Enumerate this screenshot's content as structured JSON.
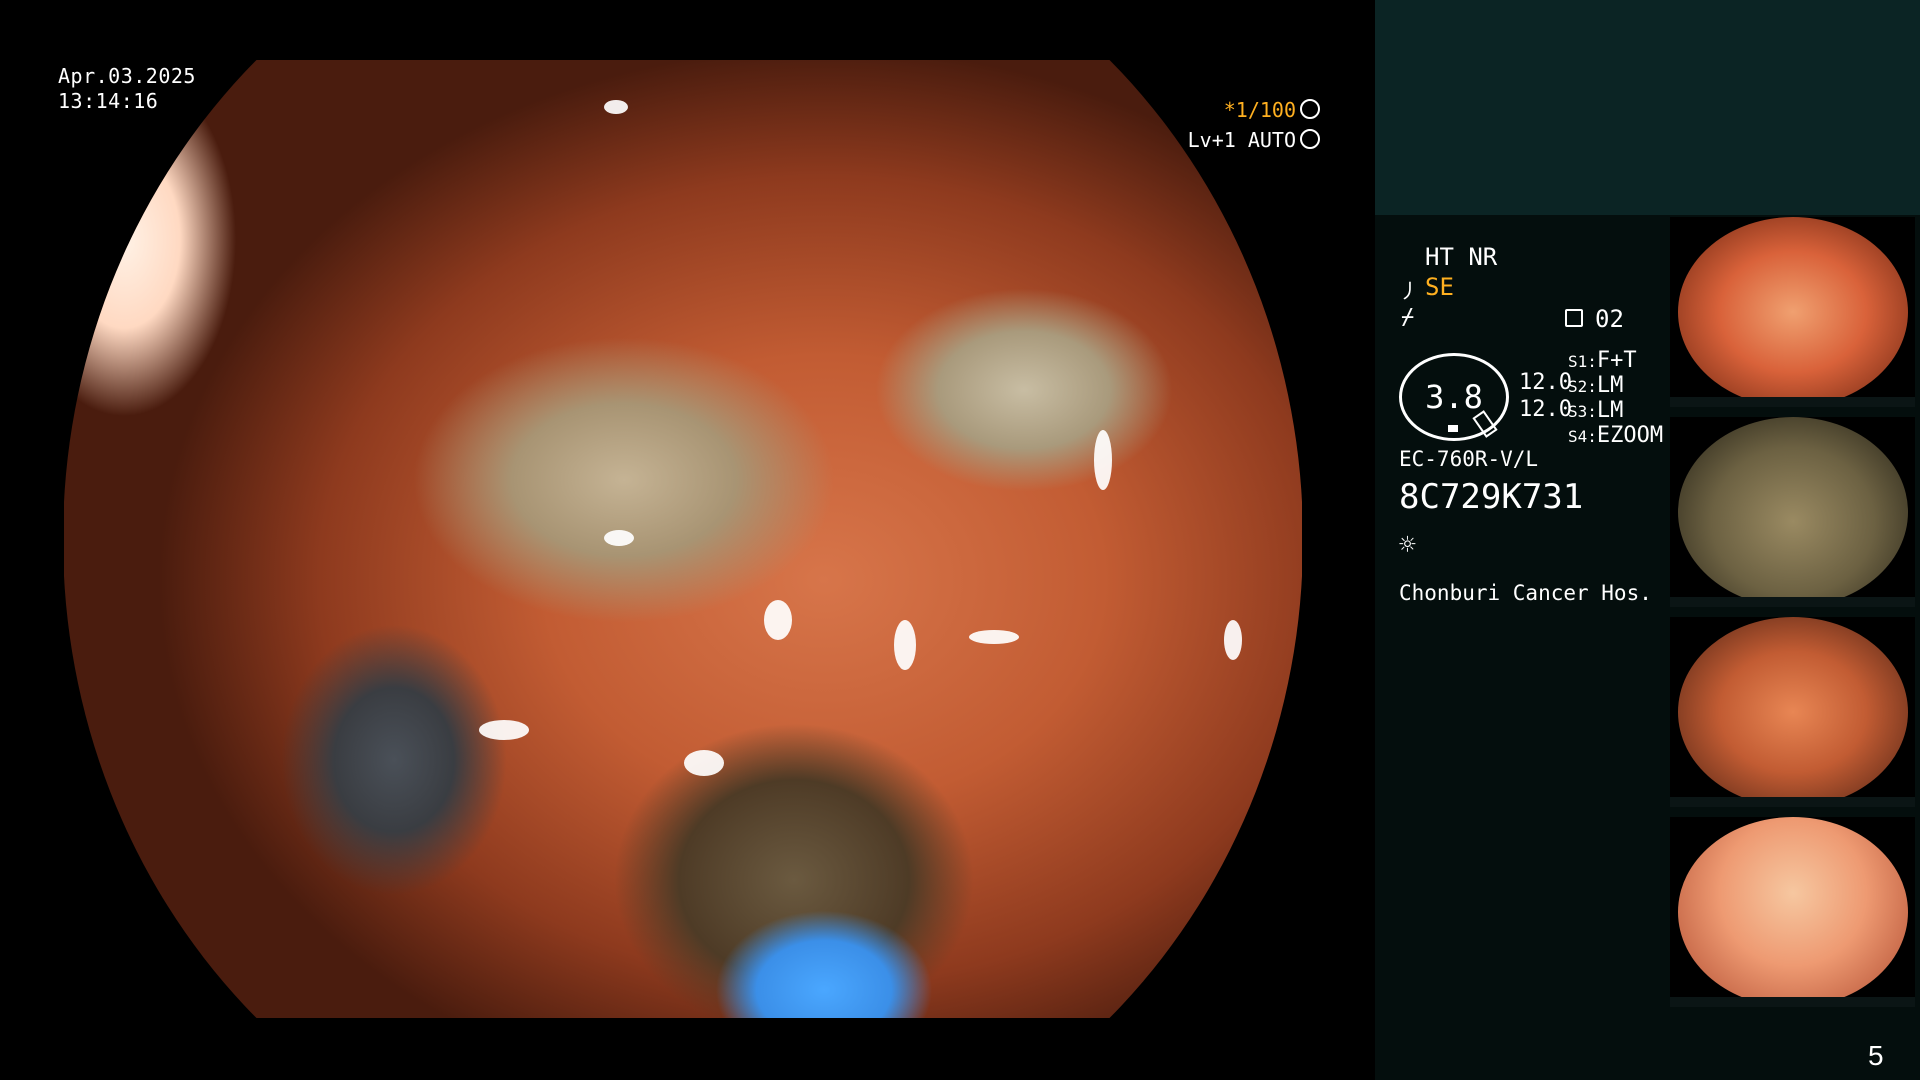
{
  "overlay": {
    "date": "Apr.03.2025",
    "time": "13:14:16",
    "shutter": "*1/100",
    "level": "Lv+1 AUTO"
  },
  "info": {
    "ht_nr": "HT NR",
    "se": "SE",
    "memory_number": "02",
    "zoom": "3.8",
    "value_1": "12.0",
    "value_2": "12.0",
    "s1_key": "S1:",
    "s1_value": "F+T",
    "s2_key": "S2:",
    "s2_value": "LM",
    "s3_key": "S3:",
    "s3_value": "LM",
    "s4_key": "S4:",
    "s4_value": "EZOOM",
    "scope_model": "EC-760R-V/L",
    "serial": "8C729K731",
    "hospital": "Chonburi Cancer Hos."
  },
  "icons": {
    "se_icon": "⼃",
    "f_icon": "⌿",
    "light_icon": "☼"
  },
  "page_number": "5",
  "colors": {
    "accent_amber": "#ffb020",
    "panel_teal": "#0b2424",
    "panel_dark": "#040e0d"
  }
}
